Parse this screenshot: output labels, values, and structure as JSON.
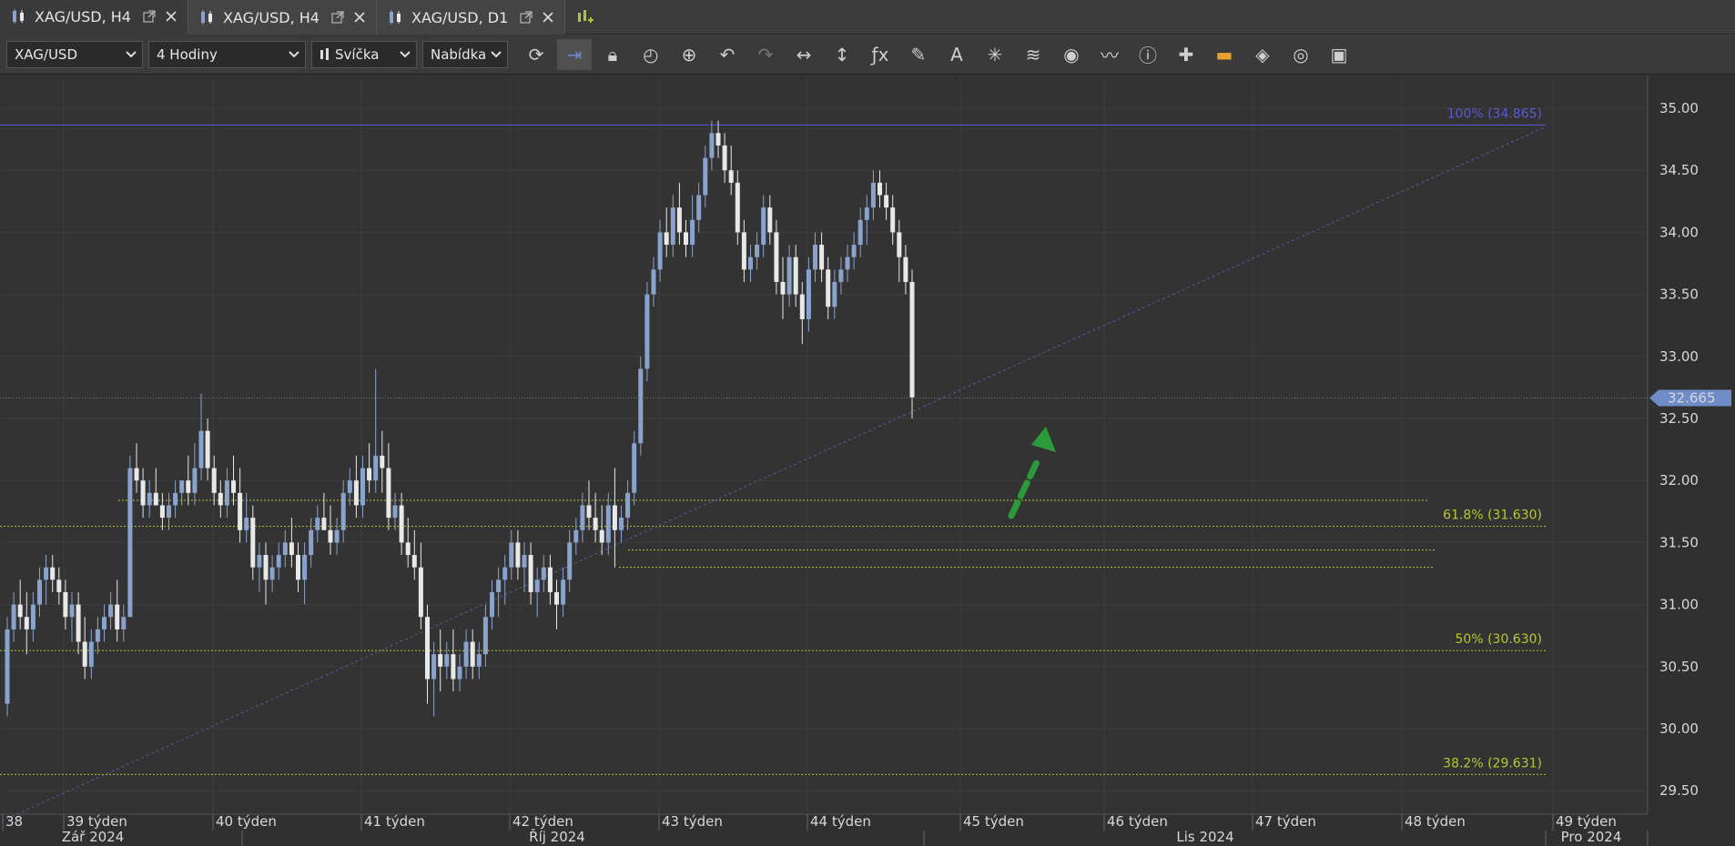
{
  "tabs": [
    {
      "label": "XAG/USD, H4",
      "active": true
    },
    {
      "label": "XAG/USD, H4",
      "active": false
    },
    {
      "label": "XAG/USD, D1",
      "active": false
    }
  ],
  "toolbar": {
    "symbol": "XAG/USD",
    "timeframe": "4 Hodiny",
    "chart_type": "Svíčka",
    "price_side": "Nabídka",
    "tools": [
      "refresh-icon",
      "autoscroll-icon",
      "lock-icon",
      "zoom-time-icon",
      "zoom-in-icon",
      "undo-icon",
      "redo-icon",
      "horizontal-resize-icon",
      "vertical-resize-icon",
      "function-icon",
      "pencil-icon",
      "text-tool-icon",
      "network-icon",
      "layers-icon",
      "eye-icon",
      "indicator-line-icon",
      "info-icon",
      "crosshair-icon",
      "heatmap-icon",
      "paint-bucket-icon",
      "reset-icon",
      "save-icon"
    ],
    "active_tool": "autoscroll-icon"
  },
  "colors": {
    "background": "#333333",
    "grid": "#3d3d3d",
    "candle_up": "#8aa3cc",
    "candle_down": "#e8e8e8",
    "fib_100": "#5a5ad6",
    "fib_yellow": "#b8c832",
    "price_tag": "#6e8cc8",
    "arrow": "#2a9a3a"
  },
  "chart_data": {
    "type": "candlestick",
    "symbol": "XAG/USD",
    "timeframe": "H4",
    "ylim": [
      29.35,
      35.25
    ],
    "y_ticks": [
      "35.00",
      "34.50",
      "34.00",
      "33.50",
      "33.00",
      "32.50",
      "32.00",
      "31.50",
      "31.00",
      "30.50",
      "30.00",
      "29.50"
    ],
    "x_ticks": [
      "38",
      "39 týden",
      "40 týden",
      "41 týden",
      "42 týden",
      "43 týden",
      "44 týden",
      "45 týden",
      "46 týden",
      "47 týden",
      "48 týden",
      "49 týden"
    ],
    "month_labels": [
      "Zář 2024",
      "Říj 2024",
      "Lis 2024",
      "Pro 2024"
    ],
    "current_price": "32.665",
    "fib_levels": [
      {
        "label": "100% (34.865)",
        "value": 34.865
      },
      {
        "label": "61.8% (31.630)",
        "value": 31.63
      },
      {
        "label": "50% (30.630)",
        "value": 30.63
      },
      {
        "label": "38.2% (29.631)",
        "value": 29.631
      }
    ],
    "support_lines": [
      31.84,
      31.44,
      31.3
    ],
    "trendline": [
      {
        "x": "38",
        "y": 29.55
      },
      {
        "x": "49 týden",
        "y": 34.85
      }
    ],
    "candles": [
      [
        30.2,
        30.9,
        30.1,
        30.8
      ],
      [
        30.8,
        31.1,
        30.7,
        31.0
      ],
      [
        31.0,
        31.2,
        30.8,
        30.9
      ],
      [
        30.9,
        31.1,
        30.6,
        30.8
      ],
      [
        30.8,
        31.1,
        30.7,
        31.0
      ],
      [
        31.0,
        31.3,
        30.9,
        31.2
      ],
      [
        31.2,
        31.4,
        31.0,
        31.3
      ],
      [
        31.3,
        31.4,
        31.1,
        31.2
      ],
      [
        31.2,
        31.3,
        31.0,
        31.1
      ],
      [
        31.1,
        31.2,
        30.8,
        30.9
      ],
      [
        30.9,
        31.1,
        30.7,
        31.0
      ],
      [
        31.0,
        31.1,
        30.6,
        30.7
      ],
      [
        30.7,
        30.9,
        30.4,
        30.5
      ],
      [
        30.5,
        30.8,
        30.4,
        30.7
      ],
      [
        30.7,
        30.9,
        30.6,
        30.8
      ],
      [
        30.8,
        31.0,
        30.7,
        30.9
      ],
      [
        30.9,
        31.1,
        30.8,
        31.0
      ],
      [
        31.0,
        31.2,
        30.7,
        30.8
      ],
      [
        30.8,
        31.0,
        30.7,
        30.9
      ],
      [
        30.9,
        32.2,
        30.9,
        32.1
      ],
      [
        32.1,
        32.3,
        31.9,
        32.0
      ],
      [
        32.0,
        32.1,
        31.7,
        31.8
      ],
      [
        31.8,
        32.0,
        31.7,
        31.9
      ],
      [
        31.9,
        32.1,
        31.8,
        31.8
      ],
      [
        31.8,
        31.9,
        31.6,
        31.7
      ],
      [
        31.7,
        31.9,
        31.6,
        31.8
      ],
      [
        31.8,
        32.0,
        31.7,
        31.9
      ],
      [
        31.9,
        32.0,
        31.8,
        32.0
      ],
      [
        32.0,
        32.2,
        31.8,
        31.9
      ],
      [
        31.9,
        32.3,
        31.8,
        32.1
      ],
      [
        32.1,
        32.7,
        32.0,
        32.4
      ],
      [
        32.4,
        32.5,
        32.0,
        32.1
      ],
      [
        32.1,
        32.2,
        31.8,
        31.9
      ],
      [
        31.9,
        32.0,
        31.7,
        31.8
      ],
      [
        31.8,
        32.1,
        31.7,
        32.0
      ],
      [
        32.0,
        32.2,
        31.8,
        31.9
      ],
      [
        31.9,
        32.1,
        31.5,
        31.6
      ],
      [
        31.6,
        31.9,
        31.5,
        31.7
      ],
      [
        31.7,
        31.8,
        31.2,
        31.3
      ],
      [
        31.3,
        31.5,
        31.1,
        31.4
      ],
      [
        31.4,
        31.5,
        31.0,
        31.2
      ],
      [
        31.2,
        31.4,
        31.1,
        31.3
      ],
      [
        31.3,
        31.5,
        31.2,
        31.4
      ],
      [
        31.4,
        31.6,
        31.3,
        31.5
      ],
      [
        31.5,
        31.7,
        31.3,
        31.4
      ],
      [
        31.4,
        31.5,
        31.1,
        31.2
      ],
      [
        31.2,
        31.5,
        31.0,
        31.4
      ],
      [
        31.4,
        31.7,
        31.3,
        31.6
      ],
      [
        31.6,
        31.8,
        31.5,
        31.7
      ],
      [
        31.7,
        31.9,
        31.6,
        31.6
      ],
      [
        31.6,
        31.8,
        31.4,
        31.5
      ],
      [
        31.5,
        31.7,
        31.4,
        31.6
      ],
      [
        31.6,
        32.0,
        31.5,
        31.9
      ],
      [
        31.9,
        32.1,
        31.8,
        32.0
      ],
      [
        32.0,
        32.2,
        31.7,
        31.8
      ],
      [
        31.8,
        32.2,
        31.7,
        32.1
      ],
      [
        32.1,
        32.3,
        31.9,
        32.0
      ],
      [
        32.0,
        32.9,
        31.9,
        32.2
      ],
      [
        32.2,
        32.4,
        31.9,
        32.1
      ],
      [
        32.1,
        32.3,
        31.6,
        31.7
      ],
      [
        31.7,
        31.9,
        31.6,
        31.8
      ],
      [
        31.8,
        31.9,
        31.4,
        31.5
      ],
      [
        31.5,
        31.7,
        31.3,
        31.4
      ],
      [
        31.4,
        31.6,
        31.2,
        31.3
      ],
      [
        31.3,
        31.5,
        30.8,
        30.9
      ],
      [
        30.9,
        31.0,
        30.2,
        30.4
      ],
      [
        30.4,
        30.7,
        30.1,
        30.6
      ],
      [
        30.6,
        30.8,
        30.3,
        30.5
      ],
      [
        30.5,
        30.7,
        30.4,
        30.6
      ],
      [
        30.6,
        30.8,
        30.3,
        30.4
      ],
      [
        30.4,
        30.6,
        30.3,
        30.5
      ],
      [
        30.5,
        30.8,
        30.4,
        30.7
      ],
      [
        30.7,
        30.8,
        30.4,
        30.5
      ],
      [
        30.5,
        30.7,
        30.4,
        30.6
      ],
      [
        30.6,
        31.0,
        30.5,
        30.9
      ],
      [
        30.9,
        31.2,
        30.8,
        31.1
      ],
      [
        31.1,
        31.3,
        30.9,
        31.2
      ],
      [
        31.2,
        31.4,
        31.0,
        31.3
      ],
      [
        31.3,
        31.6,
        31.2,
        31.5
      ],
      [
        31.5,
        31.6,
        31.2,
        31.3
      ],
      [
        31.3,
        31.5,
        31.1,
        31.4
      ],
      [
        31.4,
        31.5,
        31.0,
        31.1
      ],
      [
        31.1,
        31.3,
        30.9,
        31.2
      ],
      [
        31.2,
        31.4,
        31.1,
        31.3
      ],
      [
        31.3,
        31.4,
        31.0,
        31.1
      ],
      [
        31.1,
        31.2,
        30.8,
        31.0
      ],
      [
        31.0,
        31.3,
        30.9,
        31.2
      ],
      [
        31.2,
        31.6,
        31.1,
        31.5
      ],
      [
        31.5,
        31.7,
        31.4,
        31.6
      ],
      [
        31.6,
        31.9,
        31.5,
        31.8
      ],
      [
        31.8,
        32.0,
        31.6,
        31.7
      ],
      [
        31.7,
        31.9,
        31.5,
        31.6
      ],
      [
        31.6,
        31.8,
        31.4,
        31.5
      ],
      [
        31.5,
        31.9,
        31.4,
        31.8
      ],
      [
        31.8,
        32.1,
        31.3,
        31.6
      ],
      [
        31.6,
        31.8,
        31.5,
        31.7
      ],
      [
        31.7,
        32.0,
        31.6,
        31.9
      ],
      [
        31.9,
        32.4,
        31.8,
        32.3
      ],
      [
        32.3,
        33.0,
        32.2,
        32.9
      ],
      [
        32.9,
        33.6,
        32.8,
        33.5
      ],
      [
        33.5,
        33.8,
        33.4,
        33.7
      ],
      [
        33.7,
        34.1,
        33.6,
        34.0
      ],
      [
        34.0,
        34.2,
        33.8,
        33.9
      ],
      [
        33.9,
        34.3,
        33.8,
        34.2
      ],
      [
        34.2,
        34.4,
        33.9,
        34.0
      ],
      [
        34.0,
        34.1,
        33.8,
        33.9
      ],
      [
        33.9,
        34.3,
        33.8,
        34.1
      ],
      [
        34.1,
        34.4,
        34.0,
        34.3
      ],
      [
        34.3,
        34.7,
        34.2,
        34.6
      ],
      [
        34.6,
        34.9,
        34.5,
        34.8
      ],
      [
        34.8,
        34.9,
        34.6,
        34.7
      ],
      [
        34.7,
        34.8,
        34.4,
        34.5
      ],
      [
        34.5,
        34.7,
        34.3,
        34.4
      ],
      [
        34.4,
        34.5,
        33.9,
        34.0
      ],
      [
        34.0,
        34.1,
        33.6,
        33.7
      ],
      [
        33.7,
        33.9,
        33.6,
        33.8
      ],
      [
        33.8,
        34.0,
        33.7,
        33.9
      ],
      [
        33.9,
        34.3,
        33.8,
        34.2
      ],
      [
        34.2,
        34.3,
        33.9,
        34.0
      ],
      [
        34.0,
        34.1,
        33.5,
        33.6
      ],
      [
        33.6,
        33.8,
        33.3,
        33.5
      ],
      [
        33.5,
        33.9,
        33.4,
        33.8
      ],
      [
        33.8,
        33.9,
        33.4,
        33.5
      ],
      [
        33.5,
        33.6,
        33.1,
        33.3
      ],
      [
        33.3,
        33.8,
        33.2,
        33.7
      ],
      [
        33.7,
        34.0,
        33.6,
        33.9
      ],
      [
        33.9,
        34.0,
        33.6,
        33.7
      ],
      [
        33.7,
        33.8,
        33.3,
        33.4
      ],
      [
        33.4,
        33.7,
        33.3,
        33.6
      ],
      [
        33.6,
        33.8,
        33.5,
        33.7
      ],
      [
        33.7,
        33.9,
        33.6,
        33.8
      ],
      [
        33.8,
        34.0,
        33.7,
        33.9
      ],
      [
        33.9,
        34.2,
        33.8,
        34.1
      ],
      [
        34.1,
        34.3,
        33.9,
        34.2
      ],
      [
        34.2,
        34.5,
        34.1,
        34.4
      ],
      [
        34.4,
        34.5,
        34.2,
        34.3
      ],
      [
        34.3,
        34.4,
        34.1,
        34.2
      ],
      [
        34.2,
        34.3,
        33.9,
        34.0
      ],
      [
        34.0,
        34.1,
        33.6,
        33.8
      ],
      [
        33.8,
        33.9,
        33.5,
        33.6
      ],
      [
        33.6,
        33.7,
        32.5,
        32.67
      ]
    ]
  }
}
